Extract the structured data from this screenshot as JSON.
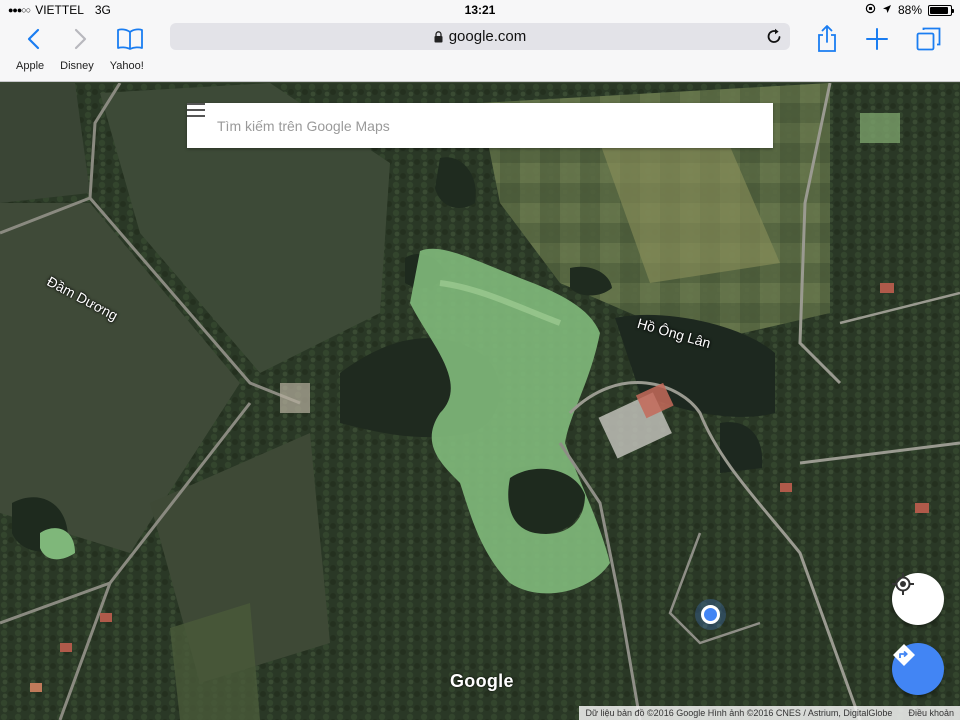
{
  "status_bar": {
    "carrier": "VIETTEL",
    "network": "3G",
    "time": "13:21",
    "battery_percent": "88%",
    "battery_level": 0.88
  },
  "safari": {
    "url": "google.com",
    "bookmarks": [
      "Apple",
      "Disney",
      "Yahoo!"
    ],
    "icons": [
      "back-icon",
      "forward-icon",
      "bookmarks-icon",
      "share-icon",
      "new-tab-icon",
      "tabs-icon",
      "lock-icon",
      "reload-icon"
    ]
  },
  "maps": {
    "search_placeholder": "Tìm kiếm trên Google Maps",
    "labels": {
      "dam_duong": "Đầm Dương",
      "ho_ong_lan": "Hồ Ông Lân"
    },
    "logo": "Google",
    "attribution": "Dữ liệu bản đồ ©2016 Google Hình ảnh ©2016 CNES / Astrium, DigitalGlobe",
    "terms": "Điều khoản",
    "accent_color": "#4285f4"
  }
}
